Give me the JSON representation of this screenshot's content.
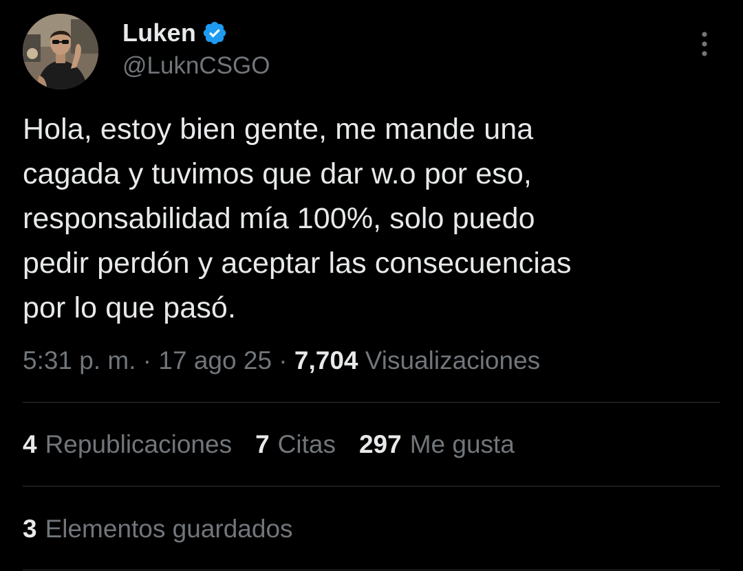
{
  "author": {
    "display_name": "Luken",
    "handle": "@LuknCSGO",
    "verified": true,
    "verified_color": "#1d9bf0"
  },
  "tweet": {
    "text": "Hola, estoy bien gente, me mande una\ncagada y tuvimos que dar w.o por eso,\nresponsabilidad mía 100%, solo puedo\npedir perdón y aceptar las consecuencias\npor lo que pasó.",
    "time": "5:31 p. m.",
    "separator": " · ",
    "date": "17 ago 25",
    "views_count": "7,704",
    "views_label": "Visualizaciones"
  },
  "stats": {
    "reposts_count": "4",
    "reposts_label": "Republicaciones",
    "quotes_count": "7",
    "quotes_label": "Citas",
    "likes_count": "297",
    "likes_label": "Me gusta",
    "bookmarks_count": "3",
    "bookmarks_label": "Elementos guardados"
  },
  "icons": {
    "avatar": "profile-photo",
    "verified": "verified-badge-icon",
    "more": "more-options-icon"
  },
  "colors": {
    "background": "#000000",
    "text_primary": "#e7e9ea",
    "text_secondary": "#71767b",
    "divider": "#2f3336"
  }
}
